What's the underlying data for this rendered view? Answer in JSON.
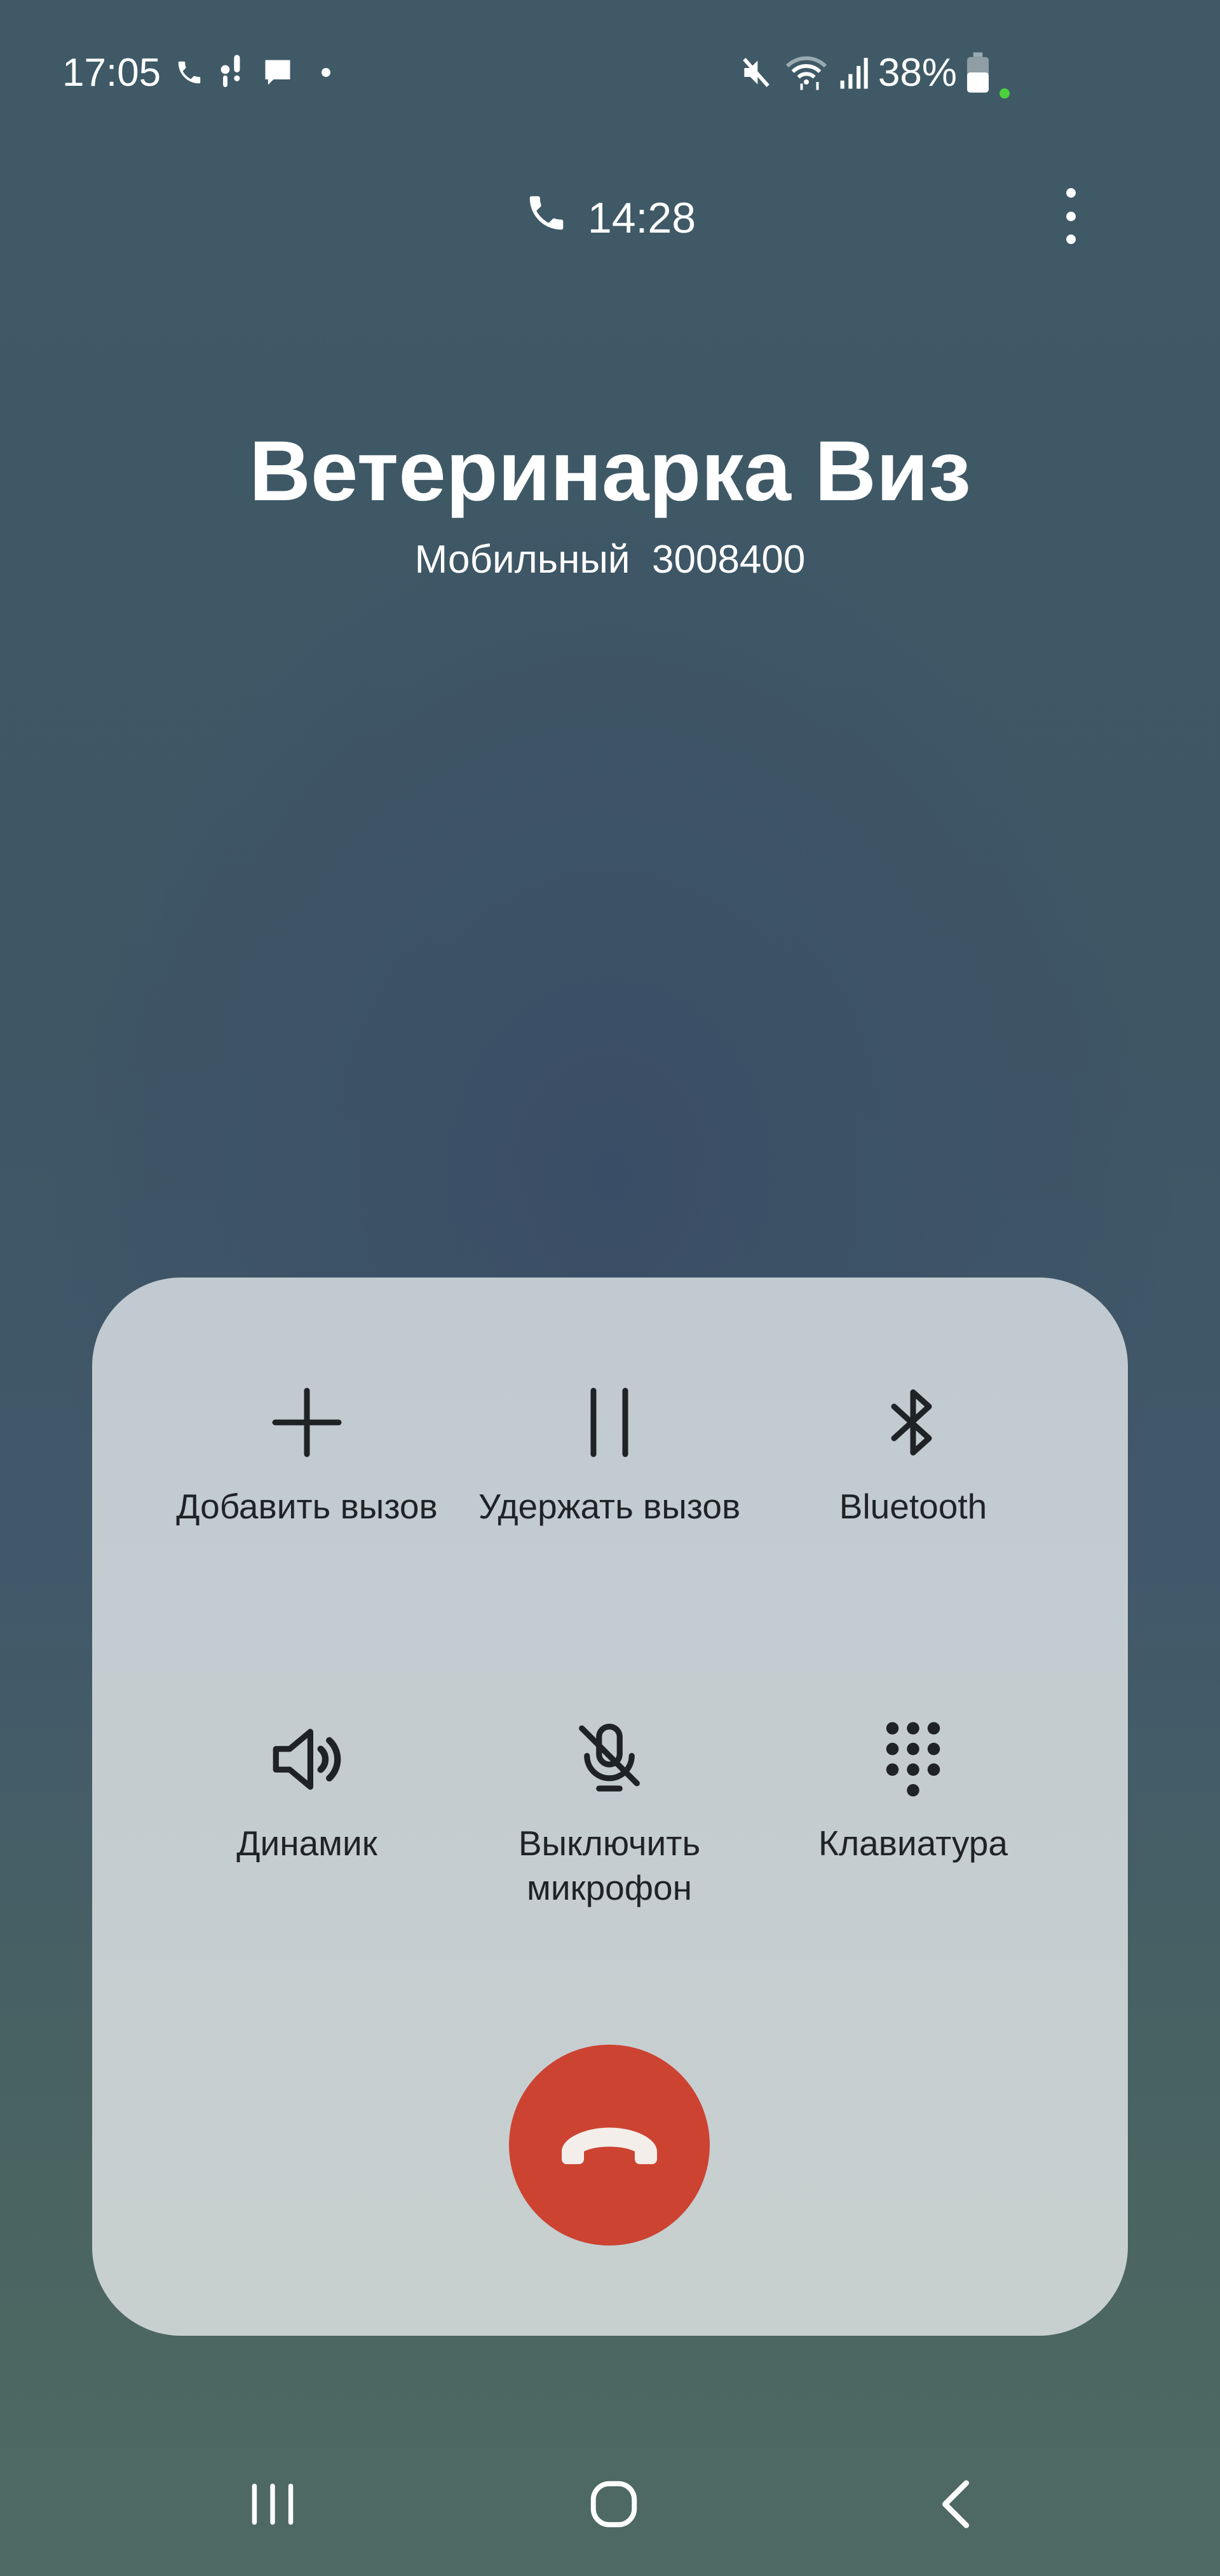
{
  "status_bar": {
    "time": "17:05",
    "battery": "38%",
    "left_icons": [
      "phone-icon",
      "voicemail-icon",
      "message-icon",
      "dot-icon"
    ],
    "right_icons": [
      "mute-icon",
      "wifi-icon",
      "signal-icon",
      "battery-icon",
      "privacy-dot-icon"
    ],
    "privacy_dot_color": "#4cd13b"
  },
  "call": {
    "duration": "14:28",
    "contact_name": "Ветеринарка Виз",
    "number_label": "Мобильный  3008400"
  },
  "controls": [
    {
      "label": "Добавить вызов",
      "icon": "plus-icon"
    },
    {
      "label": "Удержать вызов",
      "icon": "pause-icon"
    },
    {
      "label": "Bluetooth",
      "icon": "bluetooth-icon"
    },
    {
      "label": "Динамик",
      "icon": "speaker-icon"
    },
    {
      "label": "Выключить микрофон",
      "icon": "mic-off-icon"
    },
    {
      "label": "Клавиатура",
      "icon": "keypad-icon"
    }
  ],
  "end_call": {
    "icon": "end-call-icon",
    "color": "#cc4332"
  },
  "nav_bar": [
    "recents-icon",
    "home-icon",
    "back-icon"
  ]
}
